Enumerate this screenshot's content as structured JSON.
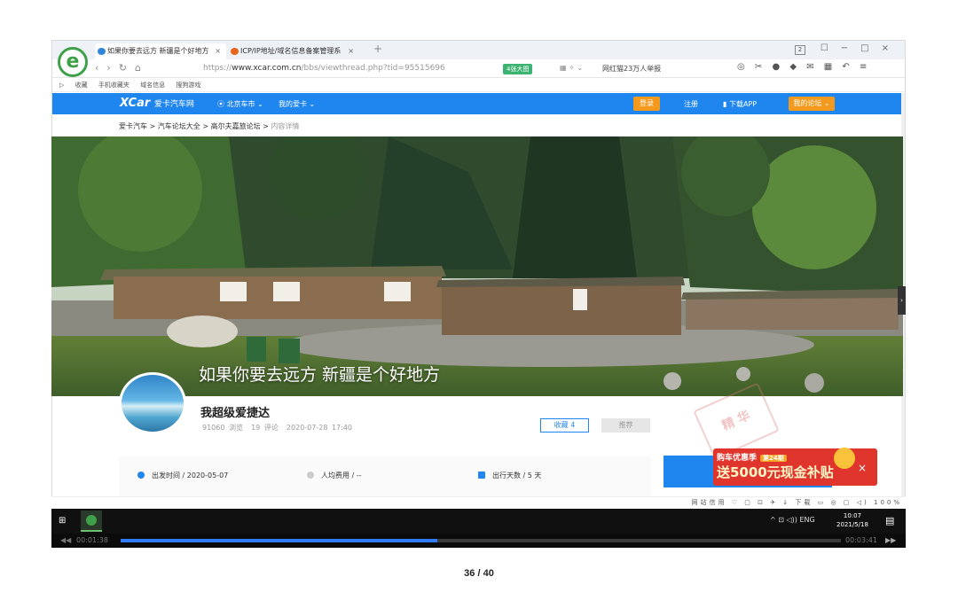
{
  "browser": {
    "tabs": [
      {
        "title": "如果你要去远方 新疆是个好地方",
        "fav_color": "#2f86d8"
      },
      {
        "title": "ICP/IP地址/域名信息备案管理系",
        "fav_color": "#e8641a"
      }
    ],
    "new_tab": "+",
    "tab_count": "2",
    "address_prefix": "https://",
    "address_domain": "www.xcar.com.cn",
    "address_path": "/bbs/viewthread.php?tid=95515696",
    "big_pic_label": "4张大图",
    "hot_news": "网红猫23万人举报",
    "bookmarks": [
      "收藏",
      "手机收藏夹",
      "域名信息",
      "搜狗游戏"
    ]
  },
  "site": {
    "brand": "爱卡汽车网",
    "city": "北京车市",
    "my_xcar": "我的爱卡",
    "login": "登录",
    "register": "注册",
    "download_app": "下载APP",
    "my_forum": "我的论坛"
  },
  "breadcrumb": {
    "items": [
      "爱卡汽车",
      "汽车论坛大全",
      "高尔夫嘉旅论坛"
    ],
    "current": "内容详情"
  },
  "post": {
    "title": "如果你要去远方 新疆是个好地方",
    "author": "我超级爱捷达",
    "views": "91060 浏览",
    "comments": "19 评论",
    "datetime": "2020-07-28 17:40",
    "favorite_label": "收藏 4",
    "recommend_label": "推荐",
    "stamp": "精 华"
  },
  "trip_info": {
    "depart": "出发时间 / 2020-05-07",
    "cost": "人均费用 / --",
    "days": "出行天数 / 5 天"
  },
  "promo": {
    "line1": "购车优惠季",
    "badge": "第24期",
    "line2": "送5000元现金补贴",
    "close": "×"
  },
  "statusbar": {
    "site_trust": "网站信用",
    "download": "下载",
    "zoom": "100%"
  },
  "taskbar": {
    "lang": "ENG",
    "time": "10:07",
    "date": "2021/5/18"
  },
  "player": {
    "elapsed": "00:01:38",
    "total": "00:03:41",
    "progress": 0.44
  },
  "page_number": "36 / 40"
}
